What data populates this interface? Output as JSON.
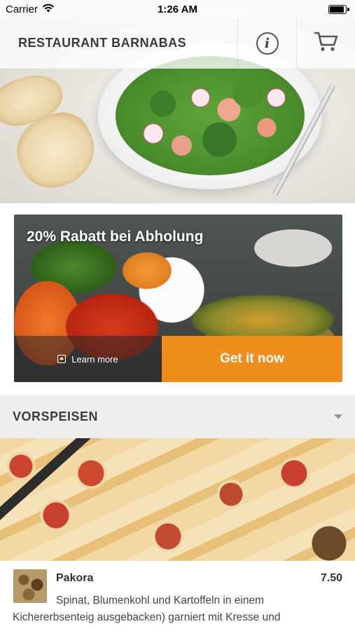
{
  "status_bar": {
    "carrier": "Carrier",
    "time": "1:26 AM",
    "icons": [
      "wifi-icon",
      "battery-icon"
    ]
  },
  "header": {
    "title": "RESTAURANT BARNABAS",
    "info_icon": "info-icon",
    "cart_icon": "cart-icon"
  },
  "promo": {
    "title": "20% Rabatt bei Abholung",
    "learn_more": "Learn more",
    "cta": "Get it now",
    "accent_color": "#ef8e1d"
  },
  "category": {
    "title": "VORSPEISEN",
    "toggle_icon": "caret-down-icon"
  },
  "menu_items": [
    {
      "name": "Pakora",
      "price": "7.50",
      "description": "Spinat, Blumenkohl und Kartoffeln in einem Kichererbsenteig ausgebacken) garniert mit Kresse und"
    }
  ]
}
